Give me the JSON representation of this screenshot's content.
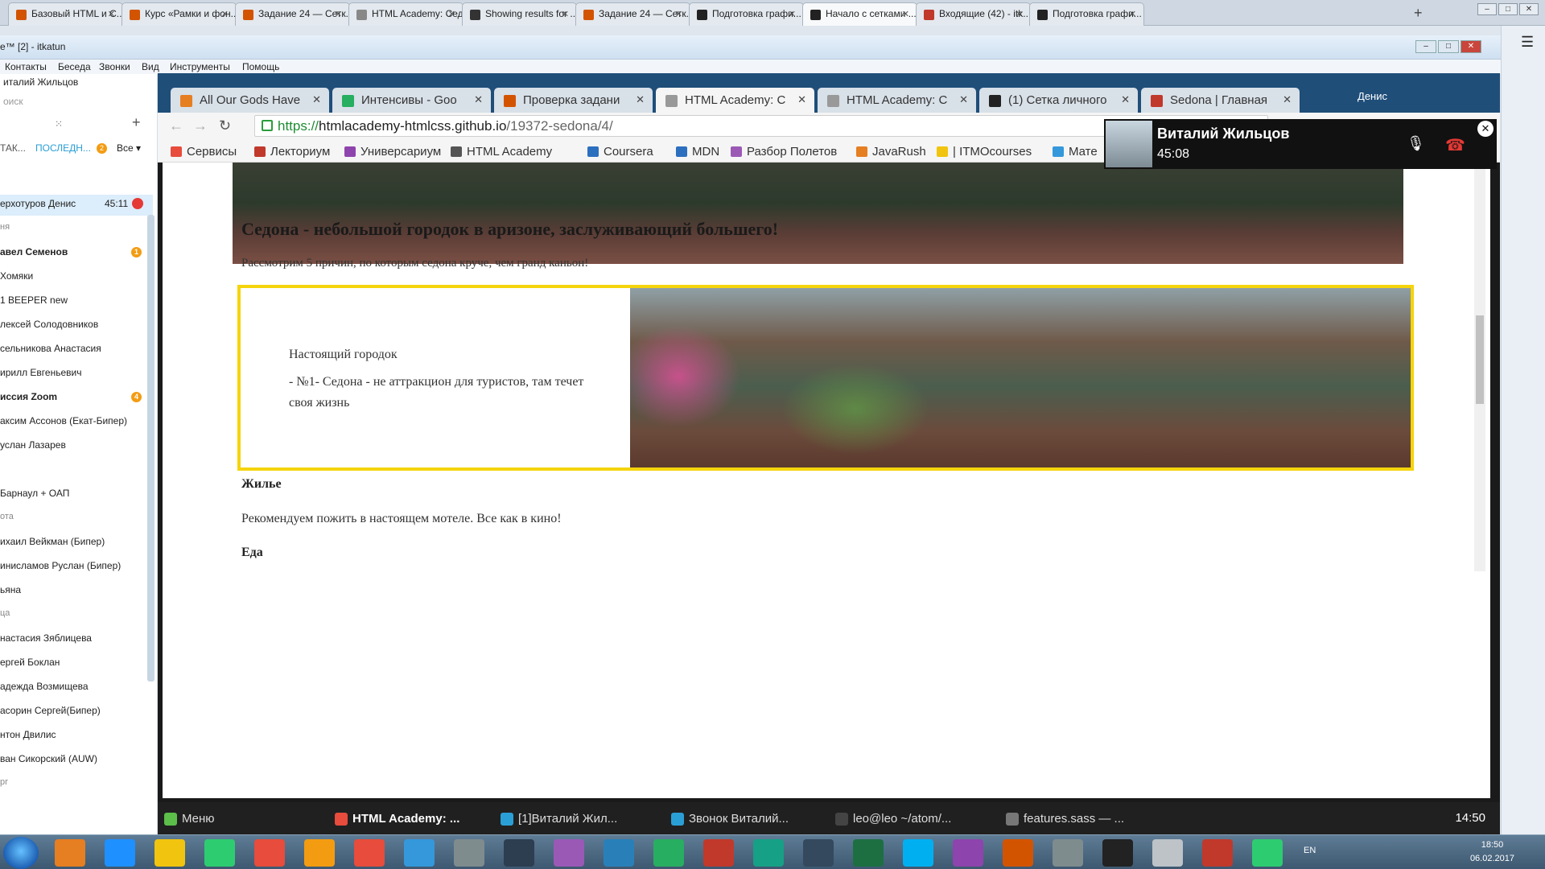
{
  "outer_tabs": [
    {
      "label": "Базовый HTML и С...",
      "color": "#d35400"
    },
    {
      "label": "Курс «Рамки и фон...",
      "color": "#d35400"
    },
    {
      "label": "Задание 24 — Сетк...",
      "color": "#d35400"
    },
    {
      "label": "HTML Academy: Седона",
      "color": "#888888"
    },
    {
      "label": "Showing results for ...",
      "color": "#333333"
    },
    {
      "label": "Задание 24 — Сетк...",
      "color": "#d35400"
    },
    {
      "label": "Подготовка графи...",
      "color": "#222222"
    },
    {
      "label": "Начало с сетками ...",
      "color": "#222222"
    },
    {
      "label": "Входящие (42) - itk...",
      "color": "#c0392b"
    },
    {
      "label": "Подготовка графи...",
      "color": "#222222"
    }
  ],
  "skype": {
    "window_title": "e™ [2] - itkatun",
    "menu": [
      "Контакты",
      "Беседа",
      "Звонки",
      "Вид",
      "Инструменты",
      "Помощь"
    ],
    "user_name": "италий Жильцов",
    "search_placeholder": "оиск",
    "list_tabs": {
      "contacts": "ТАК...",
      "recent": "ПОСЛЕДН...",
      "recent_badge": "2",
      "filter": "Все"
    },
    "contacts": [
      {
        "name": "ерхотуров Денис",
        "time": "45:11",
        "type": "selected"
      },
      {
        "name": "ня",
        "type": "group"
      },
      {
        "name": "авел Семенов",
        "type": "bold",
        "badge": "1"
      },
      {
        "name": " Хомяки",
        "type": "normal"
      },
      {
        "name": "1 BEEPER new",
        "type": "normal"
      },
      {
        "name": "лексей Солодовников",
        "type": "normal"
      },
      {
        "name": "сельникова Анастасия",
        "type": "normal"
      },
      {
        "name": "ирилл Евгеньевич",
        "type": "normal"
      },
      {
        "name": "иссия Zoom",
        "type": "bold",
        "badge": "4"
      },
      {
        "name": "аксим Ассонов (Екат-Бипер)",
        "type": "normal"
      },
      {
        "name": "услан Лазарев",
        "type": "normal"
      },
      {
        "name": "",
        "type": "normal"
      },
      {
        "name": " Барнаул + ОАП",
        "type": "normal"
      },
      {
        "name": "ота",
        "type": "group"
      },
      {
        "name": "ихаил Вейкман (Бипер)",
        "type": "normal"
      },
      {
        "name": "инисламов Руслан (Бипер)",
        "type": "normal"
      },
      {
        "name": "ьяна",
        "type": "normal"
      },
      {
        "name": "ца",
        "type": "group"
      },
      {
        "name": "настасия Зяблицева",
        "type": "normal"
      },
      {
        "name": "ергей Боклан",
        "type": "normal"
      },
      {
        "name": "адежда Возмищева",
        "type": "normal"
      },
      {
        "name": "асорин Сергей(Бипер)",
        "type": "normal"
      },
      {
        "name": "нтон Двилис",
        "type": "normal"
      },
      {
        "name": "ван Сикорский (AUW)",
        "type": "normal"
      },
      {
        "name": "рг",
        "type": "group"
      }
    ]
  },
  "inner_browser": {
    "tabs": [
      {
        "label": "All Our Gods Have",
        "color": "#e67e22"
      },
      {
        "label": "Интенсивы - Goo",
        "color": "#27ae60"
      },
      {
        "label": "Проверка задани",
        "color": "#d35400"
      },
      {
        "label": "HTML Academy: C",
        "color": "#999999"
      },
      {
        "label": "HTML Academy: C",
        "color": "#999999"
      },
      {
        "label": "(1) Сетка личного",
        "color": "#222222"
      },
      {
        "label": "Sedona | Главная",
        "color": "#c0392b"
      }
    ],
    "user_label": "Денис",
    "url": {
      "scheme": "https://",
      "host": "htmlacademy-htmlcss.github.io",
      "path": "/19372-sedona/4/"
    },
    "bookmarks": [
      {
        "label": "Сервисы",
        "color": "#e74c3c"
      },
      {
        "label": "Лекториум",
        "color": "#c0392b"
      },
      {
        "label": "Универсариум",
        "color": "#8e44ad"
      },
      {
        "label": "HTML Academy",
        "color": "#555555"
      },
      {
        "label": "Coursera",
        "color": "#2c6fbf"
      },
      {
        "label": "MDN",
        "color": "#2c6fbf"
      },
      {
        "label": "Разбор Полетов",
        "color": "#9b59b6"
      },
      {
        "label": "JavaRush",
        "color": "#e67e22"
      },
      {
        "label": "| ITMOcourses",
        "color": "#f1c40f"
      },
      {
        "label": "Мате",
        "color": "#3498db"
      }
    ],
    "page": {
      "hero_title": "Седона - небольшой городок в аризоне, заслуживающий большего!",
      "hero_subtitle": "Рассмотрим 5 причин, по которым седона круче, чем гранд каньон!",
      "feature_title": "Настоящий городок",
      "feature_text": "- №1- Седона - не аттракцион для туристов, там течет своя жизнь",
      "section1_title": "Жилье",
      "section1_text": "Рекомендуем пожить в настоящем мотеле. Все как в кино!",
      "section2_title": "Еда"
    }
  },
  "call": {
    "name": "Виталий Жильцов",
    "duration": "45:08"
  },
  "inner_taskbar": {
    "menu_label": "Меню",
    "items": [
      {
        "label": "HTML Academy: ...",
        "bold": true,
        "color": "#e74c3c"
      },
      {
        "label": "[1]Виталий Жил...",
        "bold": false,
        "color": "#2a9fd6"
      },
      {
        "label": "Звонок Виталий...",
        "bold": false,
        "color": "#2a9fd6"
      },
      {
        "label": "leo@leo ~/atom/...",
        "bold": false,
        "color": "#444444"
      },
      {
        "label": "features.sass — ...",
        "bold": false,
        "color": "#777777"
      }
    ],
    "clock": "14:50"
  },
  "win_taskbar": {
    "lang": "EN",
    "time": "18:50",
    "date": "06.02.2017",
    "icons": [
      "#e67e22",
      "#1e90ff",
      "#f1c40f",
      "#2ecc71",
      "#e74c3c",
      "#f39c12",
      "#e74c3c",
      "#3498db",
      "#7f8c8d",
      "#2c3e50",
      "#9b59b6",
      "#2980b9",
      "#27ae60",
      "#c0392b",
      "#16a085",
      "#34495e",
      "#1d6f42",
      "#00aff0",
      "#8e44ad",
      "#d35400",
      "#7f8c8d",
      "#222222",
      "#bdc3c7",
      "#c0392b",
      "#2ecc71"
    ]
  }
}
